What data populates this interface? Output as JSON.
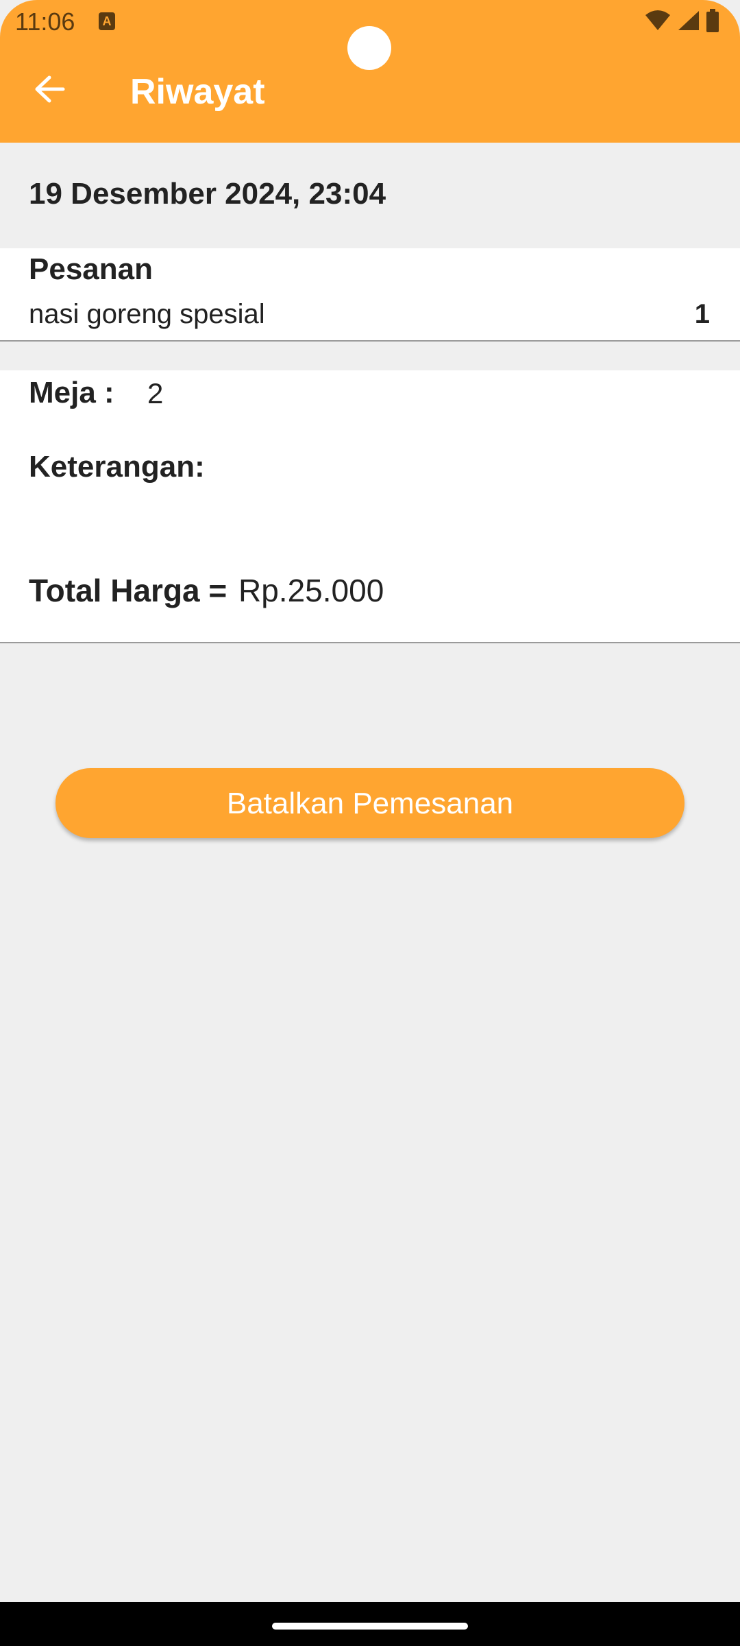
{
  "status_bar": {
    "time": "11:06",
    "app_icon_letter": "A"
  },
  "app_bar": {
    "title": "Riwayat",
    "background_color": "#FFA530"
  },
  "order": {
    "datetime": "19 Desember 2024, 23:04",
    "section_title": "Pesanan",
    "items": [
      {
        "name": "nasi goreng spesial",
        "quantity": "1"
      }
    ],
    "table_label": "Meja :",
    "table_value": "2",
    "notes_label": "Keterangan:",
    "total_label": "Total Harga =",
    "total_value": "Rp.25.000"
  },
  "actions": {
    "cancel_label": "Batalkan Pemesanan"
  },
  "icons": {
    "back": "arrow-left-icon",
    "wifi": "wifi-icon",
    "signal": "cell-signal-icon",
    "battery": "battery-icon"
  }
}
